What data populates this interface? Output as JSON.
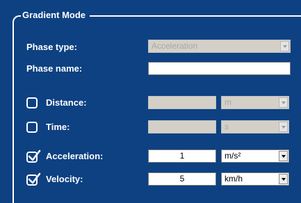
{
  "group": {
    "title": "Gradient Mode"
  },
  "phase_type": {
    "label": "Phase type:",
    "value": "Acceleration"
  },
  "phase_name": {
    "label": "Phase name:",
    "value": ""
  },
  "distance": {
    "label": "Distance:",
    "checked": false,
    "value": "",
    "unit": "m"
  },
  "time": {
    "label": "Time:",
    "checked": false,
    "value": "",
    "unit": "s"
  },
  "acceleration": {
    "label": "Acceleration:",
    "checked": true,
    "value": "1",
    "unit": "m/s²"
  },
  "velocity": {
    "label": "Velocity:",
    "checked": true,
    "value": "5",
    "unit": "km/h"
  },
  "colors": {
    "background": "#0d4182",
    "text": "#ffffff",
    "disabled_field": "#d4d0c8"
  }
}
